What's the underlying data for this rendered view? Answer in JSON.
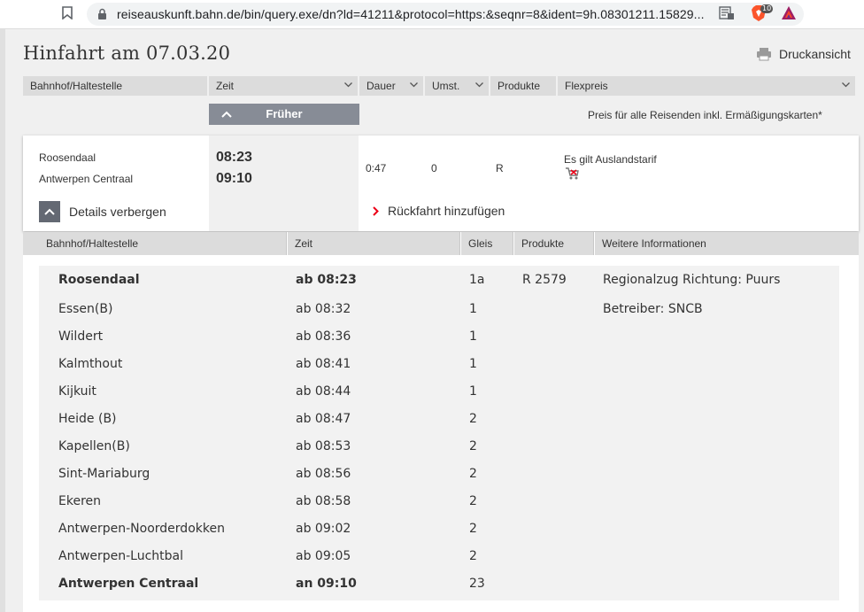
{
  "browser": {
    "url": "reiseauskunft.bahn.de/bin/query.exe/dn?ld=41211&protocol=https:&seqnr=8&ident=9h.08301211.15829...",
    "brave_badge": "10"
  },
  "page": {
    "title": "Hinfahrt am 07.03.20",
    "print_label": "Druckansicht",
    "columns": {
      "station": "Bahnhof/Haltestelle",
      "time": "Zeit",
      "duration": "Dauer",
      "changes": "Umst.",
      "products": "Produkte",
      "fare": "Flexpreis"
    },
    "earlier_label": "Früher",
    "price_note": "Preis für alle Reisenden inkl. Ermäßigungskarten*"
  },
  "connection": {
    "from": "Roosendaal",
    "to": "Antwerpen Centraal",
    "dep": "08:23",
    "arr": "09:10",
    "duration": "0:47",
    "changes": "0",
    "products": "R",
    "fare_note": "Es gilt Auslandstarif",
    "details_label": "Details verbergen",
    "return_label": "Rückfahrt hinzufügen"
  },
  "details": {
    "headers": {
      "station": "Bahnhof/Haltestelle",
      "time": "Zeit",
      "track": "Gleis",
      "products": "Produkte",
      "info": "Weitere Informationen"
    },
    "train": "R 2579",
    "info_direction": "Regionalzug Richtung: Puurs",
    "info_operator": "Betreiber: SNCB",
    "stops": [
      {
        "station": "Roosendaal",
        "time": "ab 08:23",
        "track": "1a"
      },
      {
        "station": "Essen(B)",
        "time": "ab 08:32",
        "track": "1"
      },
      {
        "station": "Wildert",
        "time": "ab 08:36",
        "track": "1"
      },
      {
        "station": "Kalmthout",
        "time": "ab 08:41",
        "track": "1"
      },
      {
        "station": "Kijkuit",
        "time": "ab 08:44",
        "track": "1"
      },
      {
        "station": "Heide (B)",
        "time": "ab 08:47",
        "track": "2"
      },
      {
        "station": "Kapellen(B)",
        "time": "ab 08:53",
        "track": "2"
      },
      {
        "station": "Sint-Mariaburg",
        "time": "ab 08:56",
        "track": "2"
      },
      {
        "station": "Ekeren",
        "time": "ab 08:58",
        "track": "2"
      },
      {
        "station": "Antwerpen-Noorderdokken",
        "time": "ab 09:02",
        "track": "2"
      },
      {
        "station": "Antwerpen-Luchtbal",
        "time": "ab 09:05",
        "track": "2"
      },
      {
        "station": "Antwerpen Centraal",
        "time": "an 09:10",
        "track": "23"
      }
    ]
  },
  "colors": {
    "header_bg": "#dcdcdc",
    "button_grey": "#878c96",
    "accent_red": "#ec0016"
  }
}
